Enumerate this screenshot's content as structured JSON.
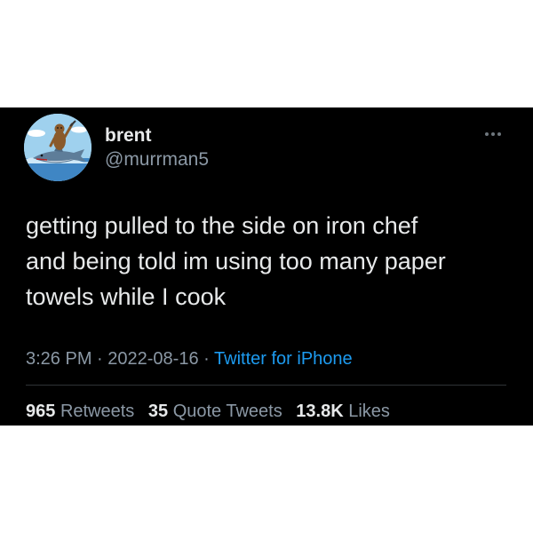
{
  "tweet": {
    "display_name": "brent",
    "handle": "@murrman5",
    "text": "getting pulled to the side on iron chef\nand being told im using too many paper\ntowels while I cook",
    "time": "3:26 PM",
    "separator": "·",
    "date": "2022-08-16",
    "source": "Twitter for iPhone",
    "more_icon": "more-horizontal-icon",
    "avatar_icon": "otter-riding-shark-icon"
  },
  "stats": {
    "retweets_count": "965",
    "retweets_label": "Retweets",
    "quotes_count": "35",
    "quotes_label": "Quote Tweets",
    "likes_count": "13.8K",
    "likes_label": "Likes"
  },
  "colors": {
    "background": "#000000",
    "text": "#e7e9ea",
    "secondary_text": "#8b98a5",
    "link": "#1d9bf0",
    "divider": "#2f3336"
  }
}
